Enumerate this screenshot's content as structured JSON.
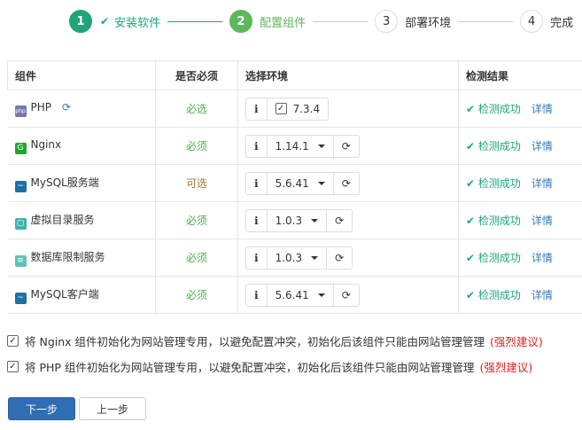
{
  "steps": [
    {
      "num": "1",
      "label": "安装软件",
      "state": "done"
    },
    {
      "num": "2",
      "label": "配置组件",
      "state": "active"
    },
    {
      "num": "3",
      "label": "部署环境",
      "state": "todo"
    },
    {
      "num": "4",
      "label": "完成",
      "state": "todo"
    }
  ],
  "table": {
    "headers": [
      "组件",
      "是否必须",
      "选择环境",
      "检测结果"
    ],
    "rows": [
      {
        "name": "PHP",
        "icon": "php-icon",
        "required": "必选",
        "version": "7.3.4",
        "result": "检测成功",
        "detail": "详情"
      },
      {
        "name": "Nginx",
        "icon": "nginx-icon",
        "required": "必须",
        "version": "1.14.1",
        "result": "检测成功",
        "detail": "详情"
      },
      {
        "name": "MySQL服务端",
        "icon": "mysql-icon",
        "required": "可选",
        "version": "5.6.41",
        "result": "检测成功",
        "detail": "详情"
      },
      {
        "name": "虚拟目录服务",
        "icon": "folder-service-icon",
        "required": "必须",
        "version": "1.0.3",
        "result": "检测成功",
        "detail": "详情"
      },
      {
        "name": "数据库限制服务",
        "icon": "database-limit-icon",
        "required": "必须",
        "version": "1.0.3",
        "result": "检测成功",
        "detail": "详情"
      },
      {
        "name": "MySQL客户端",
        "icon": "mysql-icon",
        "required": "必须",
        "version": "5.6.41",
        "result": "检测成功",
        "detail": "详情"
      }
    ]
  },
  "options": [
    {
      "text": "将 Nginx 组件初始化为网站管理专用，以避免配置冲突，初始化后该组件只能由网站管理管理",
      "note": "(强烈建议)",
      "checked": true
    },
    {
      "text": "将 PHP 组件初始化为网站管理专用，以避免配置冲突，初始化后该组件只能由网站管理管理",
      "note": "(强烈建议)",
      "checked": true
    }
  ],
  "buttons": {
    "next": "下一步",
    "prev": "上一步"
  },
  "colors": {
    "success": "#20a57a",
    "active": "#5cb85c",
    "primary": "#2f6db5",
    "warning": "#e02020"
  }
}
